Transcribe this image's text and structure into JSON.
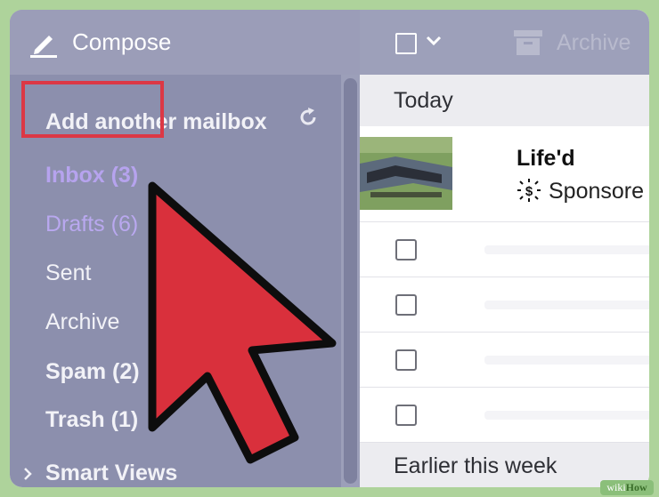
{
  "sidebar": {
    "compose_label": "Compose",
    "add_mailbox": "Add another mailbox",
    "folders": [
      {
        "label": "Inbox (3)"
      },
      {
        "label": "Drafts (6)"
      },
      {
        "label": "Sent"
      },
      {
        "label": "Archive"
      },
      {
        "label": "Spam (2)"
      },
      {
        "label": "Trash (1)"
      },
      {
        "label": "Smart Views"
      }
    ],
    "icons": {
      "compose": "pencil-icon",
      "refresh": "refresh-icon",
      "expand": "chevron-right-icon"
    }
  },
  "toolbar": {
    "archive_label": "Archive",
    "icons": {
      "select": "checkbox-icon",
      "select_menu": "chevron-down-icon",
      "archive": "archive-box-icon"
    }
  },
  "messages": {
    "section_today": "Today",
    "ad": {
      "sender": "Life'd",
      "sponsored": "Sponsore"
    },
    "section_earlier": "Earlier this week"
  },
  "watermark": {
    "part1": "wiki",
    "part2": "How"
  },
  "colors": {
    "highlight": "#dc3845",
    "arrow": "#d9303c",
    "inbox": "#b6a3ee",
    "sidebar": "#8c8fad"
  }
}
